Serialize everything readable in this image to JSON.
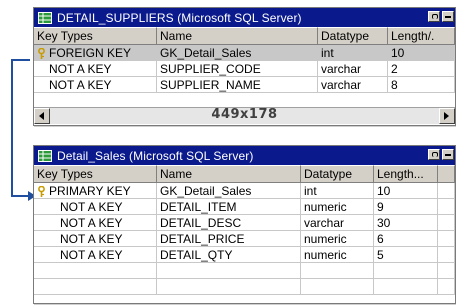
{
  "windows": {
    "suppliers": {
      "title": "DETAIL_SUPPLIERS (Microsoft SQL Server)",
      "columns": [
        "Key Types",
        "Name",
        "Datatype",
        "Length/."
      ],
      "rows": [
        {
          "key": "FOREIGN KEY",
          "name": "GK_Detail_Sales",
          "datatype": "int",
          "length": "10"
        },
        {
          "key": "NOT A KEY",
          "name": "SUPPLIER_CODE",
          "datatype": "varchar",
          "length": "2"
        },
        {
          "key": "NOT A KEY",
          "name": "SUPPLIER_NAME",
          "datatype": "varchar",
          "length": "8"
        }
      ],
      "size_label": "449x178"
    },
    "sales": {
      "title": "Detail_Sales (Microsoft SQL Server)",
      "columns": [
        "Key Types",
        "Name",
        "Datatype",
        "Length..."
      ],
      "rows": [
        {
          "key": "PRIMARY KEY",
          "name": "GK_Detail_Sales",
          "datatype": "int",
          "length": "10"
        },
        {
          "key": "NOT A KEY",
          "name": "DETAIL_ITEM",
          "datatype": "numeric",
          "length": "9"
        },
        {
          "key": "NOT A KEY",
          "name": "DETAIL_DESC",
          "datatype": "varchar",
          "length": "30"
        },
        {
          "key": "NOT A KEY",
          "name": "DETAIL_PRICE",
          "datatype": "numeric",
          "length": "6"
        },
        {
          "key": "NOT A KEY",
          "name": "DETAIL_QTY",
          "datatype": "numeric",
          "length": "5"
        }
      ]
    }
  },
  "icons": {
    "table": "table-icon",
    "key": "key-icon",
    "help": "help-icon",
    "minimize": "minimize-icon",
    "scroll_left": "arrow-left-icon",
    "scroll_right": "arrow-right-icon"
  },
  "colors": {
    "titlebar": "#0a1a8c",
    "connector": "#1f4f9e",
    "key": "#c89b00"
  }
}
